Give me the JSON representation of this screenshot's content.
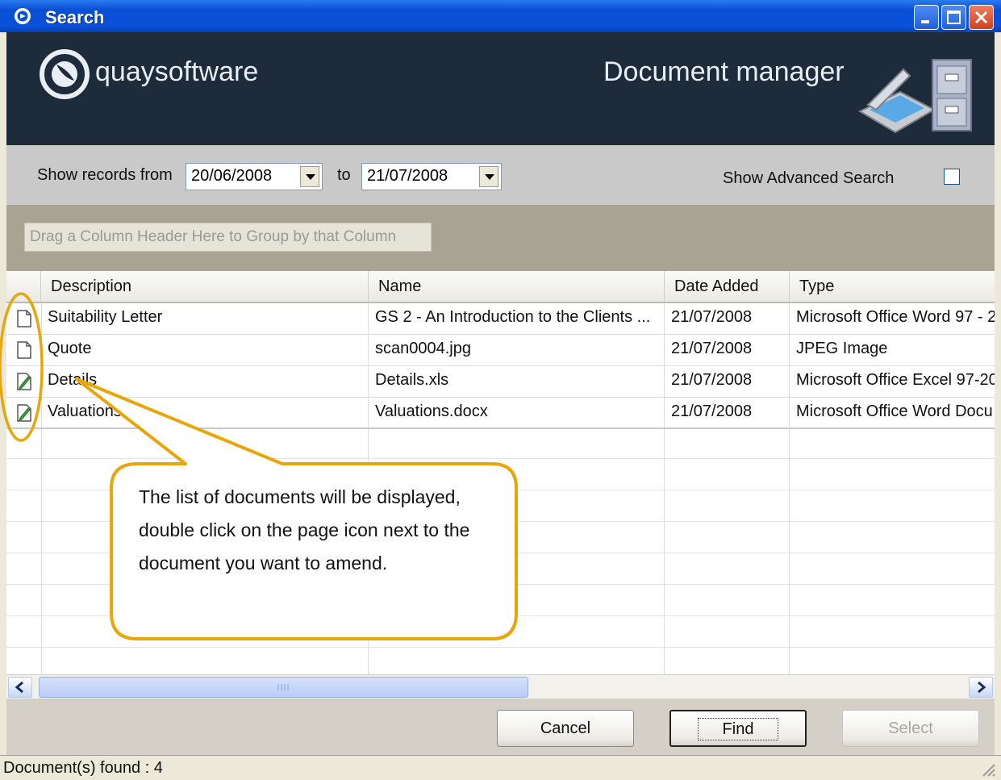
{
  "window": {
    "title": "Search"
  },
  "banner": {
    "brand": "quaysoftware",
    "title": "Document manager"
  },
  "filter": {
    "from_label": "Show records from",
    "from_date": "20/06/2008",
    "to_label": "to",
    "to_date": "21/07/2008",
    "advanced_label": "Show Advanced Search",
    "advanced_checked": false
  },
  "grid": {
    "group_hint": "Drag a Column Header Here to Group by that Column",
    "columns": [
      "Description",
      "Name",
      "Date Added",
      "Type"
    ],
    "rows": [
      {
        "icon": "document-icon",
        "description": "Suitability Letter",
        "name": "GS 2 - An Introduction to the Clients ...",
        "date": "21/07/2008",
        "type": "Microsoft Office Word 97 - 2"
      },
      {
        "icon": "document-icon",
        "description": "Quote",
        "name": "scan0004.jpg",
        "date": "21/07/2008",
        "type": "JPEG Image"
      },
      {
        "icon": "edit-document-icon",
        "description": "Details",
        "name": "Details.xls",
        "date": "21/07/2008",
        "type": "Microsoft Office Excel 97-20"
      },
      {
        "icon": "edit-document-icon",
        "description": "Valuations",
        "name": "Valuations.docx",
        "date": "21/07/2008",
        "type": "Microsoft Office Word Docu"
      }
    ]
  },
  "buttons": {
    "cancel": "Cancel",
    "find": "Find",
    "select": "Select"
  },
  "status": {
    "text": "Document(s) found : 4"
  },
  "callout": {
    "text": "The list of documents will be displayed, double click on the page icon next to the document you want to amend."
  },
  "colors": {
    "titlebar": "#0A52DA",
    "banner": "#1D2B3B",
    "callout_border": "#E8A60C"
  }
}
